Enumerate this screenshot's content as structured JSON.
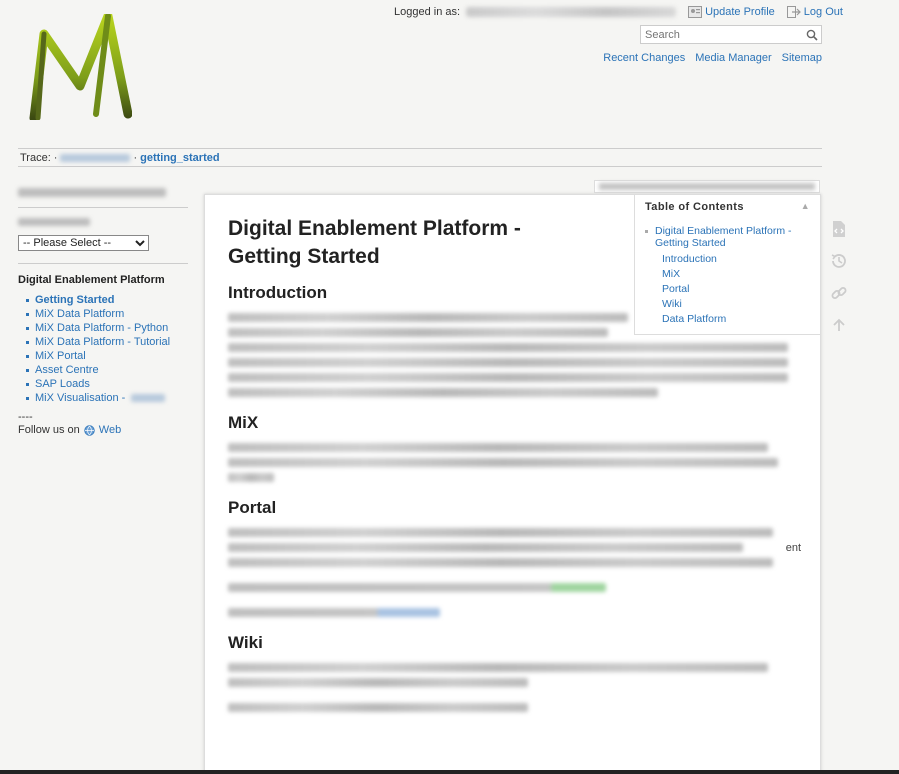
{
  "header": {
    "logged_in_label": "Logged in as:",
    "update_profile": "Update Profile",
    "log_out": "Log Out",
    "search_placeholder": "Search",
    "site_tools": [
      "Recent Changes",
      "Media Manager",
      "Sitemap"
    ]
  },
  "trace": {
    "label": "Trace:",
    "current": "getting_started"
  },
  "sidebar": {
    "select_default": "-- Please Select --",
    "heading": "Digital Enablement Platform",
    "items": [
      {
        "label": "Getting Started",
        "active": true
      },
      {
        "label": "MiX Data Platform"
      },
      {
        "label": "MiX Data Platform - Python"
      },
      {
        "label": "MiX Data Platform - Tutorial"
      },
      {
        "label": "MiX Portal"
      },
      {
        "label": "Asset Centre"
      },
      {
        "label": "SAP Loads"
      },
      {
        "label": "MiX Visualisation -"
      }
    ],
    "separator_text": "----",
    "follow_label": "Follow us on",
    "follow_link": "Web"
  },
  "toc": {
    "title": "Table of Contents",
    "toggle": "▲",
    "top_item": "Digital Enablement Platform - Getting Started",
    "sub_items": [
      "Introduction",
      "MiX",
      "Portal",
      "Wiki",
      "Data Platform"
    ]
  },
  "content": {
    "title": "Digital Enablement Platform - Getting Started",
    "sections": [
      "Introduction",
      "MiX",
      "Portal",
      "Wiki"
    ],
    "portal_fragment": "ent"
  },
  "colors": {
    "link": "#2b73b7",
    "logo_green": "#9bc01c"
  }
}
